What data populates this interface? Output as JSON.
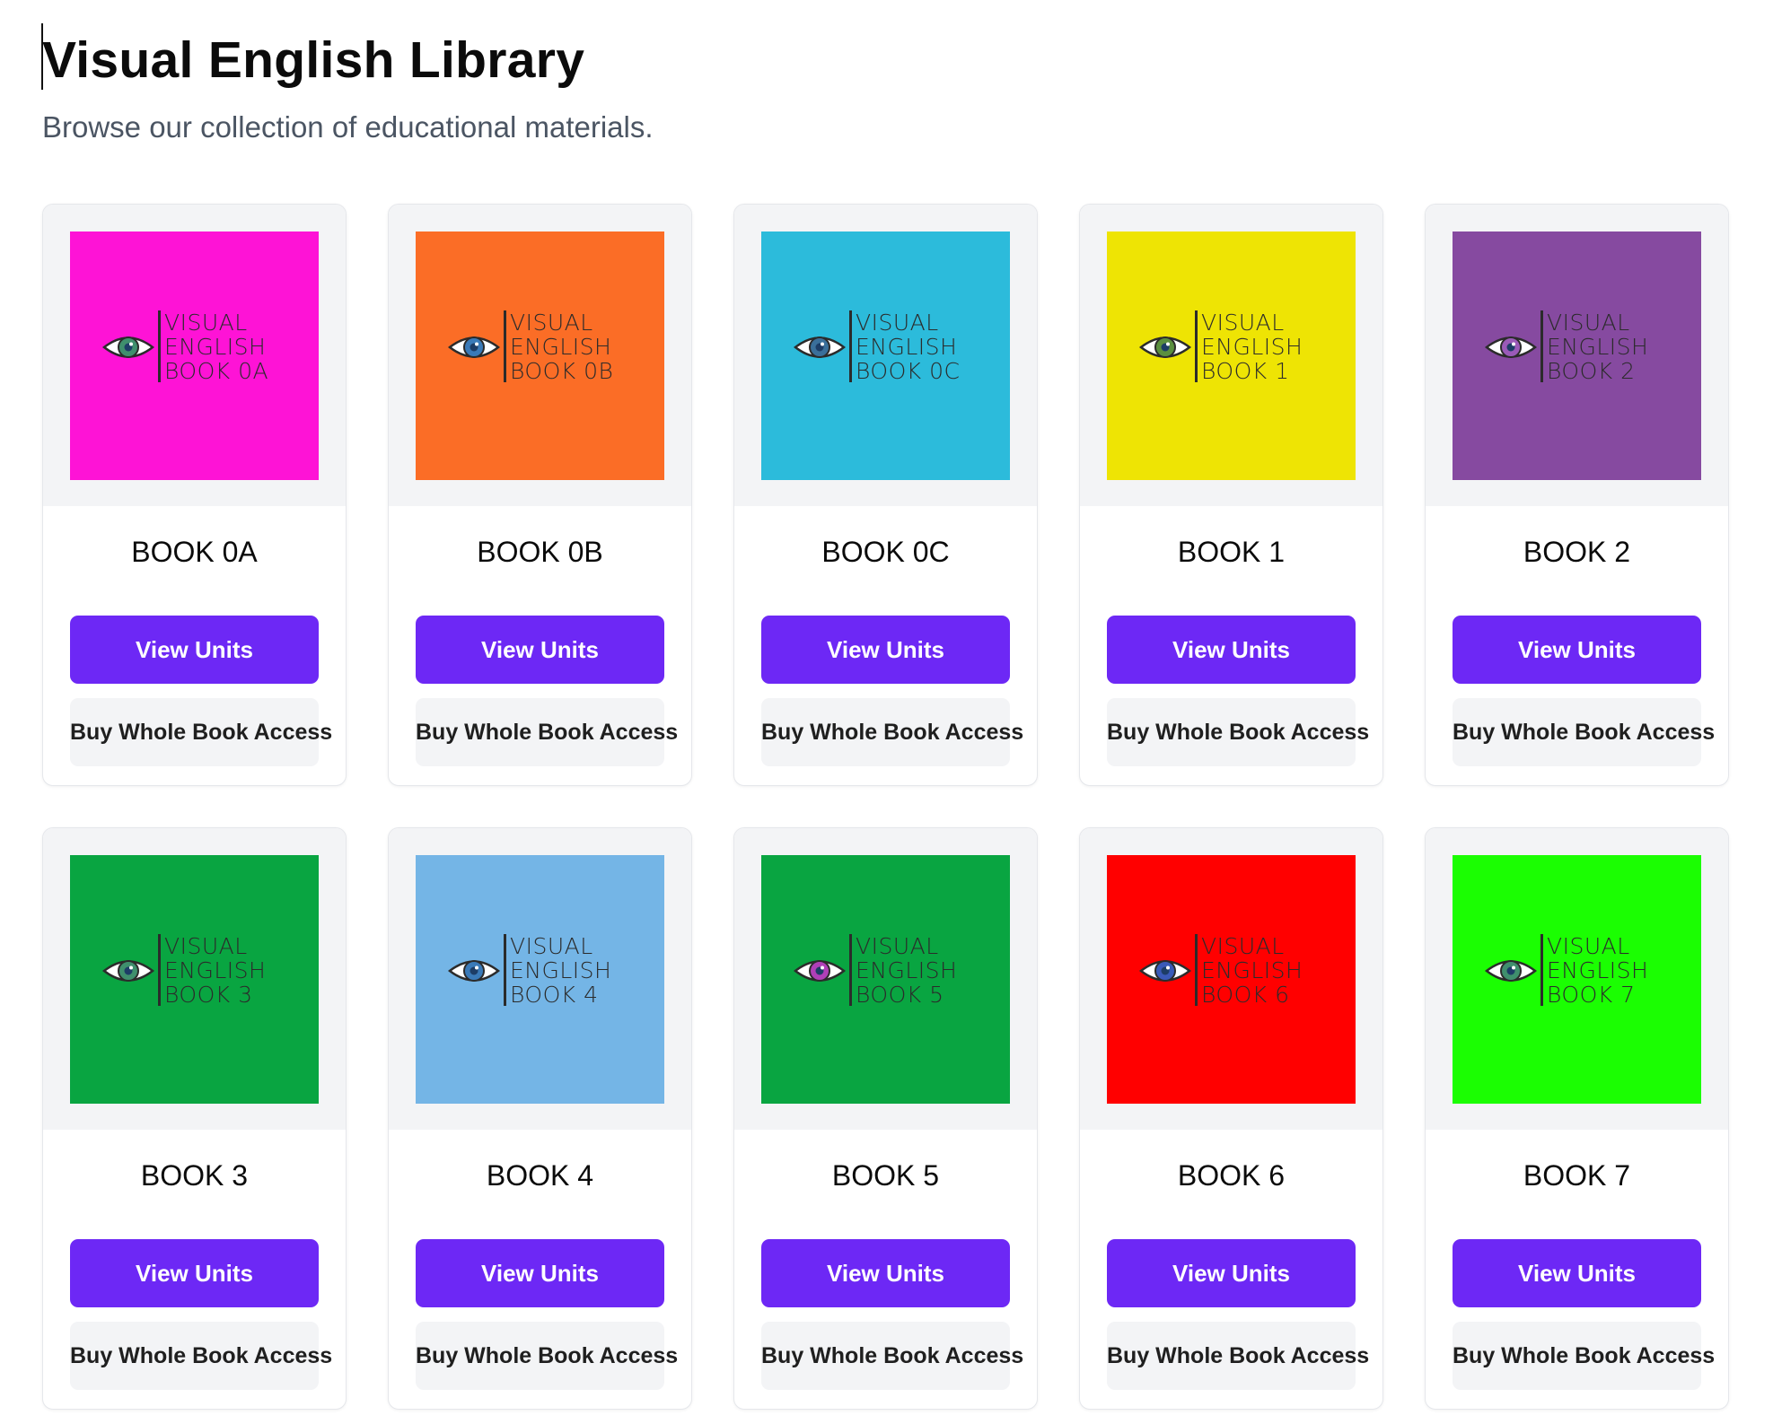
{
  "header": {
    "title": "Visual English Library",
    "subtitle": "Browse our collection of educational materials."
  },
  "buttons": {
    "view_units": "View Units",
    "buy_access": "Buy Whole Book Access"
  },
  "books": [
    {
      "title": "BOOK 0A",
      "cover_line1": "VISUAL",
      "cover_line2": "ENGLISH",
      "cover_line3": "BOOK 0A",
      "cover_color": "#fe13d6",
      "iris_color": "#3f8f6d"
    },
    {
      "title": "BOOK 0B",
      "cover_line1": "VISUAL",
      "cover_line2": "ENGLISH",
      "cover_line3": "BOOK 0B",
      "cover_color": "#fb6d26",
      "iris_color": "#3a7ab8"
    },
    {
      "title": "BOOK 0C",
      "cover_line1": "VISUAL",
      "cover_line2": "ENGLISH",
      "cover_line3": "BOOK 0C",
      "cover_color": "#2cbbdb",
      "iris_color": "#3a6f9a"
    },
    {
      "title": "BOOK 1",
      "cover_line1": "VISUAL",
      "cover_line2": "ENGLISH",
      "cover_line3": "BOOK 1",
      "cover_color": "#eee404",
      "iris_color": "#5a8f3f"
    },
    {
      "title": "BOOK 2",
      "cover_line1": "VISUAL",
      "cover_line2": "ENGLISH",
      "cover_line3": "BOOK 2",
      "cover_color": "#864aa0",
      "iris_color": "#9a5ab8"
    },
    {
      "title": "BOOK 3",
      "cover_line1": "VISUAL",
      "cover_line2": "ENGLISH",
      "cover_line3": "BOOK 3",
      "cover_color": "#09a541",
      "iris_color": "#3f8f6d"
    },
    {
      "title": "BOOK 4",
      "cover_line1": "VISUAL",
      "cover_line2": "ENGLISH",
      "cover_line3": "BOOK 4",
      "cover_color": "#74b5e6",
      "iris_color": "#3a7ab8"
    },
    {
      "title": "BOOK 5",
      "cover_line1": "VISUAL",
      "cover_line2": "ENGLISH",
      "cover_line3": "BOOK 5",
      "cover_color": "#09a541",
      "iris_color": "#b03fb8"
    },
    {
      "title": "BOOK 6",
      "cover_line1": "VISUAL",
      "cover_line2": "ENGLISH",
      "cover_line3": "BOOK 6",
      "cover_color": "#ff0000",
      "iris_color": "#3a5ab8"
    },
    {
      "title": "BOOK 7",
      "cover_line1": "VISUAL",
      "cover_line2": "ENGLISH",
      "cover_line3": "BOOK 7",
      "cover_color": "#1bfe02",
      "iris_color": "#3f8f6d"
    }
  ],
  "colors": {
    "accent": "#6d28f5",
    "secondary_button": "#f3f4f6",
    "cover_ink": "#2b2b2b"
  }
}
